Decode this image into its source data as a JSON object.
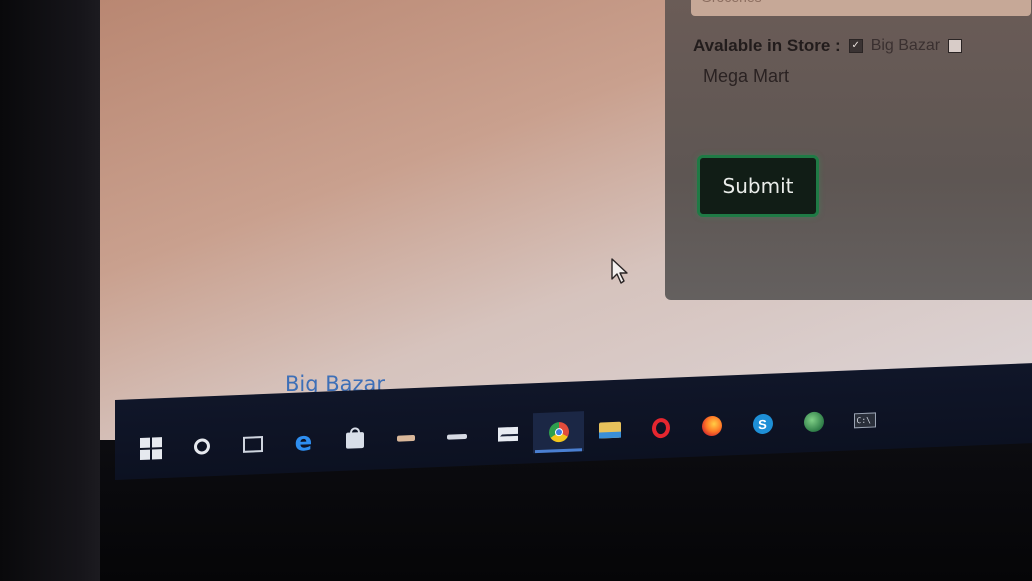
{
  "form": {
    "category_value": "Groceries",
    "store_label": "Avalable in Store :",
    "stores": [
      {
        "label": "Big Bazar",
        "checked": true
      },
      {
        "label": "Mega Mart",
        "checked": false
      }
    ],
    "submit_label": "Submit"
  },
  "page": {
    "link_text": "Big Bazar"
  },
  "taskbar": {
    "items": [
      {
        "icon": "windows-start-icon"
      },
      {
        "icon": "cortana-search-icon"
      },
      {
        "icon": "task-view-icon"
      },
      {
        "icon": "edge-browser-icon"
      },
      {
        "icon": "microsoft-store-icon"
      },
      {
        "icon": "tool-app-icon"
      },
      {
        "icon": "app-icon"
      },
      {
        "icon": "mail-icon"
      },
      {
        "icon": "chrome-icon",
        "active": true
      },
      {
        "icon": "file-explorer-icon"
      },
      {
        "icon": "opera-icon"
      },
      {
        "icon": "firefox-icon"
      },
      {
        "icon": "skype-icon"
      },
      {
        "icon": "globe-app-icon"
      },
      {
        "icon": "terminal-icon"
      }
    ],
    "edge_glyph": "e",
    "skype_glyph": "S",
    "terminal_glyph": "C:\\",
    "accent_color": "#4a7fd1"
  },
  "colors": {
    "submit_border": "#1f7a45",
    "link": "#3d6fb7"
  }
}
